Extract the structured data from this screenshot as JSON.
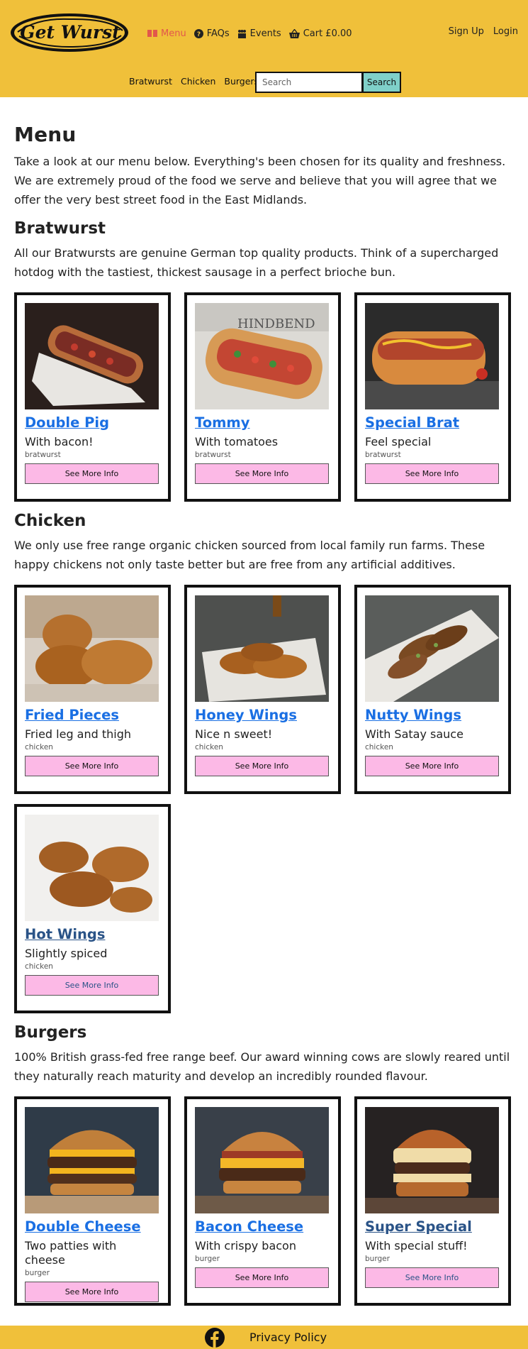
{
  "header": {
    "logo_text": "Get Wurst",
    "nav": [
      {
        "label": "Menu",
        "icon": "menu-book-icon",
        "active": true
      },
      {
        "label": "FAQs",
        "icon": "question-circle-icon"
      },
      {
        "label": "Events",
        "icon": "people-icon"
      },
      {
        "label": "Cart £0.00",
        "icon": "basket-icon"
      }
    ],
    "signup_label": "Sign Up",
    "login_label": "Login"
  },
  "subnav": {
    "links": [
      "Bratwurst",
      "Chicken",
      "Burgers"
    ],
    "search_placeholder": "Search",
    "search_button": "Search"
  },
  "page": {
    "title": "Menu",
    "intro": "Take a look at our menu below. Everything's been chosen for its quality and freshness. We are extremely proud of the food we serve and believe that you will agree that we offer the very best street food in the East Midlands."
  },
  "sections": [
    {
      "title": "Bratwurst",
      "description": "All our Bratwursts are genuine German top quality products. Think of a supercharged hotdog with the tastiest, thickest sausage in a perfect brioche bun.",
      "items": [
        {
          "name": "Double Pig",
          "desc": "With bacon!",
          "tag": "bratwurst",
          "button": "See More Info",
          "image": "hotdog-bacon-photo"
        },
        {
          "name": "Tommy",
          "desc": "With tomatoes",
          "tag": "bratwurst",
          "button": "See More Info",
          "image": "hotdog-tomato-photo"
        },
        {
          "name": "Special Brat",
          "desc": "Feel special",
          "tag": "bratwurst",
          "button": "See More Info",
          "image": "hotdog-special-photo"
        }
      ]
    },
    {
      "title": "Chicken",
      "description": "We only use free range organic chicken sourced from local family run farms. These happy chickens not only taste better but are free from any artificial additives.",
      "items": [
        {
          "name": "Fried Pieces",
          "desc": "Fried leg and thigh",
          "tag": "chicken",
          "button": "See More Info",
          "image": "fried-chicken-photo"
        },
        {
          "name": "Honey Wings",
          "desc": "Nice n sweet!",
          "tag": "chicken",
          "button": "See More Info",
          "image": "honey-wings-photo"
        },
        {
          "name": "Nutty Wings",
          "desc": "With Satay sauce",
          "tag": "chicken",
          "button": "See More Info",
          "image": "satay-wings-photo"
        },
        {
          "name": "Hot Wings",
          "desc": "Slightly spiced",
          "tag": "chicken",
          "button": "See More Info",
          "image": "hot-wings-photo",
          "visited": true
        }
      ]
    },
    {
      "title": "Burgers",
      "description": "100% British grass-fed free range beef. Our award winning cows are slowly reared until they naturally reach maturity and develop an incredibly rounded flavour.",
      "items": [
        {
          "name": "Double Cheese",
          "desc": "Two patties with cheese",
          "tag": "burger",
          "button": "See More Info",
          "image": "double-cheeseburger-photo"
        },
        {
          "name": "Bacon Cheese",
          "desc": "With crispy bacon",
          "tag": "burger",
          "button": "See More Info",
          "image": "bacon-cheeseburger-photo"
        },
        {
          "name": "Super Special",
          "desc": "With special stuff!",
          "tag": "burger",
          "button": "See More Info",
          "image": "special-burger-photo",
          "visited": true
        }
      ]
    }
  ],
  "footer": {
    "social_icon": "facebook-icon",
    "privacy_label": "Privacy Policy"
  },
  "colors": {
    "header_bg": "#f0c03a",
    "active_nav": "#e2574b",
    "link": "#1a6fe3",
    "visited_link": "#2a5387",
    "button_bg": "#fcb9e6",
    "search_button_bg": "#7fd0c9"
  }
}
